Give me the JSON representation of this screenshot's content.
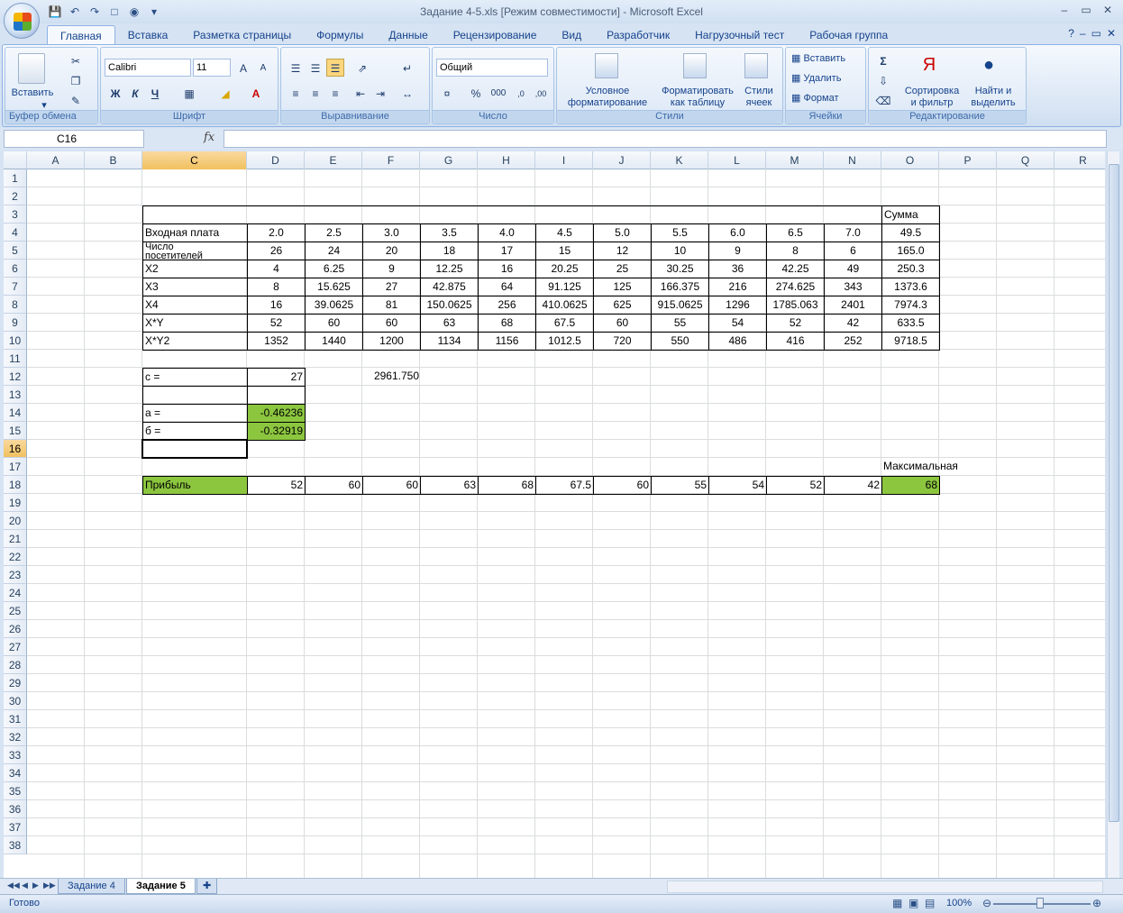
{
  "window": {
    "title": "Задание 4-5.xls  [Режим совместимости] - Microsoft Excel"
  },
  "tabs": [
    "Главная",
    "Вставка",
    "Разметка страницы",
    "Формулы",
    "Данные",
    "Рецензирование",
    "Вид",
    "Разработчик",
    "Нагрузочный тест",
    "Рабочая группа"
  ],
  "ribbon": {
    "clipboard": {
      "label": "Буфер обмена",
      "paste": "Вставить"
    },
    "font": {
      "label": "Шрифт",
      "name": "Calibri",
      "size": "11",
      "bold": "Ж",
      "italic": "К",
      "underline": "Ч"
    },
    "alignment": {
      "label": "Выравнивание"
    },
    "number": {
      "label": "Число",
      "format": "Общий",
      "percent": "%",
      "thousands": "000"
    },
    "styles": {
      "label": "Стили",
      "cond1": "Условное",
      "cond2": "форматирование",
      "fmt1": "Форматировать",
      "fmt2": "как таблицу",
      "cell1": "Стили",
      "cell2": "ячеек"
    },
    "cells": {
      "label": "Ячейки",
      "insert": "Вставить",
      "delete": "Удалить",
      "format": "Формат"
    },
    "editing": {
      "label": "Редактирование",
      "sort1": "Сортировка",
      "sort2": "и фильтр",
      "find1": "Найти и",
      "find2": "выделить"
    }
  },
  "formula_bar": {
    "name_box": "C16",
    "formula": ""
  },
  "columns": [
    "A",
    "B",
    "C",
    "D",
    "E",
    "F",
    "G",
    "H",
    "I",
    "J",
    "K",
    "L",
    "M",
    "N",
    "O",
    "P",
    "Q",
    "R"
  ],
  "rows": [
    "1",
    "2",
    "3",
    "4",
    "5",
    "6",
    "7",
    "8",
    "9",
    "10",
    "11",
    "12",
    "13",
    "14",
    "15",
    "16",
    "17",
    "18",
    "19",
    "20",
    "21",
    "22",
    "23",
    "24",
    "25",
    "26",
    "27",
    "28",
    "29",
    "30",
    "31",
    "32",
    "33",
    "34",
    "35",
    "36",
    "37",
    "38"
  ],
  "cells": {
    "O3": "Сумма",
    "C4": "Входная плата",
    "D4": "2.0",
    "E4": "2.5",
    "F4": "3.0",
    "G4": "3.5",
    "H4": "4.0",
    "I4": "4.5",
    "J4": "5.0",
    "K4": "5.5",
    "L4": "6.0",
    "M4": "6.5",
    "N4": "7.0",
    "O4": "49.5",
    "C5a": "Число",
    "C5b": "посетителей",
    "D5": "26",
    "E5": "24",
    "F5": "20",
    "G5": "18",
    "H5": "17",
    "I5": "15",
    "J5": "12",
    "K5": "10",
    "L5": "9",
    "M5": "8",
    "N5": "6",
    "O5": "165.0",
    "C6": "X2",
    "D6": "4",
    "E6": "6.25",
    "F6": "9",
    "G6": "12.25",
    "H6": "16",
    "I6": "20.25",
    "J6": "25",
    "K6": "30.25",
    "L6": "36",
    "M6": "42.25",
    "N6": "49",
    "O6": "250.3",
    "C7": "X3",
    "D7": "8",
    "E7": "15.625",
    "F7": "27",
    "G7": "42.875",
    "H7": "64",
    "I7": "91.125",
    "J7": "125",
    "K7": "166.375",
    "L7": "216",
    "M7": "274.625",
    "N7": "343",
    "O7": "1373.6",
    "C8": "X4",
    "D8": "16",
    "E8": "39.0625",
    "F8": "81",
    "G8": "150.0625",
    "H8": "256",
    "I8": "410.0625",
    "J8": "625",
    "K8": "915.0625",
    "L8": "1296",
    "M8": "1785.063",
    "N8": "2401",
    "O8": "7974.3",
    "C9": "X*Y",
    "D9": "52",
    "E9": "60",
    "F9": "60",
    "G9": "63",
    "H9": "68",
    "I9": "67.5",
    "J9": "60",
    "K9": "55",
    "L9": "54",
    "M9": "52",
    "N9": "42",
    "O9": "633.5",
    "C10": "X*Y2",
    "D10": "1352",
    "E10": "1440",
    "F10": "1200",
    "G10": "1134",
    "H10": "1156",
    "I10": "1012.5",
    "J10": "720",
    "K10": "550",
    "L10": "486",
    "M10": "416",
    "N10": "252",
    "O10": "9718.5",
    "C12": "с =",
    "D12": "27",
    "F12": "2961.750",
    "C14": "а =",
    "D14": "-0.46236",
    "C15": "б =",
    "D15": "-0.32919",
    "O17": "Максимальная",
    "C18": "Прибыль",
    "D18": "52",
    "E18": "60",
    "F18": "60",
    "G18": "63",
    "H18": "68",
    "I18": "67.5",
    "J18": "60",
    "K18": "55",
    "L18": "54",
    "M18": "52",
    "N18": "42",
    "O18": "68"
  },
  "sheets": [
    "Задание 4",
    "Задание 5"
  ],
  "status": {
    "ready": "Готово",
    "zoom": "100%"
  },
  "colors": {
    "highlight": "#8cc63f"
  }
}
